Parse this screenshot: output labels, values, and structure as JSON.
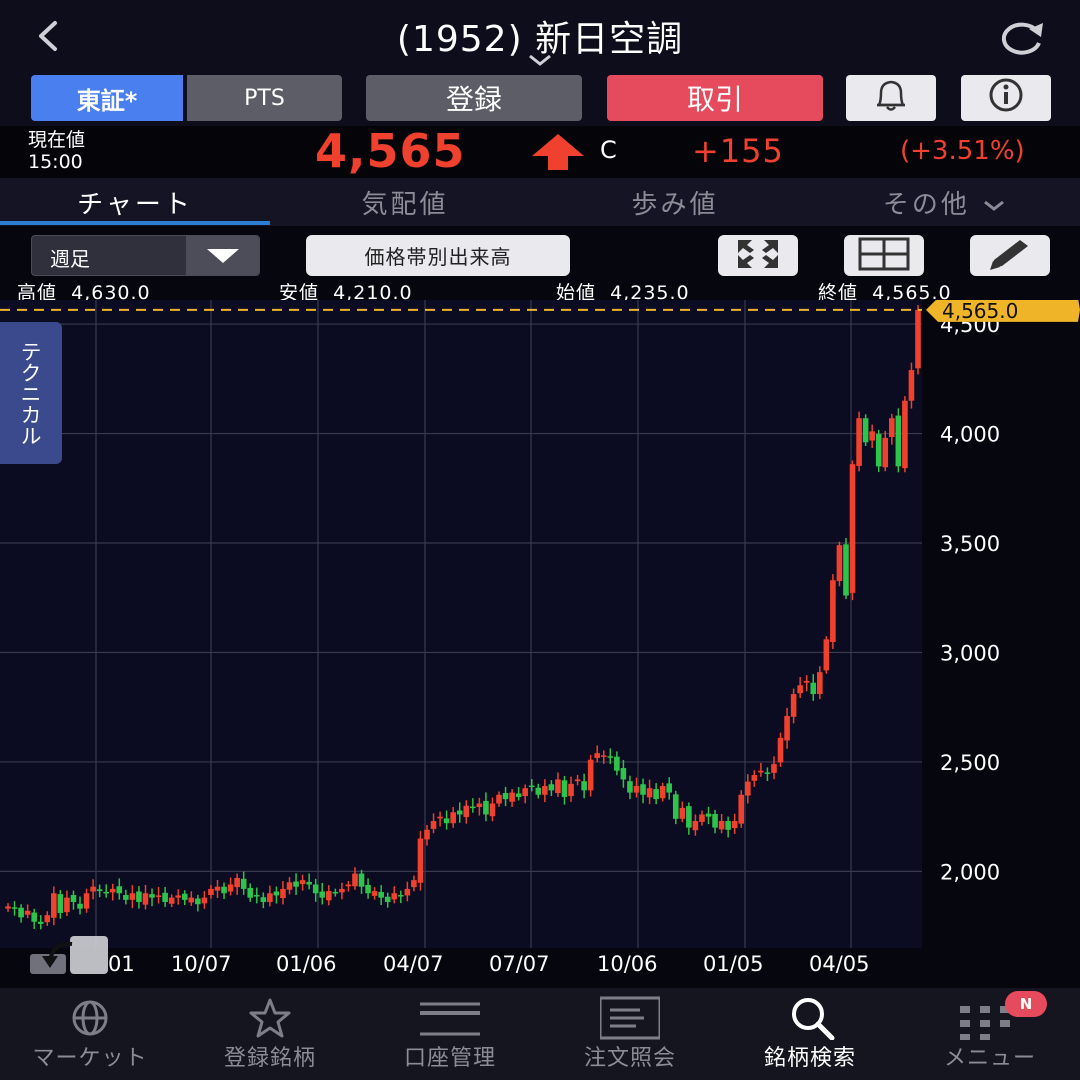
{
  "header": {
    "title": "(1952) 新日空調"
  },
  "toolbar": {
    "exchange_tosho": "東証*",
    "exchange_pts": "PTS",
    "register": "登録",
    "trade": "取引"
  },
  "quote": {
    "label": "現在値",
    "time": "15:00",
    "price": "4,565",
    "c_mark": "C",
    "change": "+155",
    "change_pct": "(+3.51%)",
    "up_color": "#f0412f"
  },
  "tabs": [
    "チャート",
    "気配値",
    "歩み値",
    "その他"
  ],
  "controls": {
    "period": "週足",
    "volume_button": "価格帯別出来高"
  },
  "ohlc": {
    "high_label": "高値",
    "high": "4,630.0",
    "low_label": "安値",
    "low": "4,210.0",
    "open_label": "始値",
    "open": "4,235.0",
    "close_label": "終値",
    "close": "4,565.0"
  },
  "side_tab": "テクニカル",
  "chart_data": {
    "type": "candlestick",
    "y_ticks": [
      4500,
      4000,
      3500,
      3000,
      2500,
      2000
    ],
    "y_tick_labels": [
      "4,500",
      "4,000",
      "3,500",
      "3,000",
      "2,500",
      "2,000"
    ],
    "x_tick_labels": [
      "01",
      "10/07",
      "01/06",
      "04/07",
      "07/07",
      "10/06",
      "01/05",
      "04/05"
    ],
    "last_price_label": "4,565.0",
    "last_price": 4565,
    "ylim": [
      1650,
      4610
    ],
    "up_color": "#f0412f",
    "down_color": "#2ec34a",
    "grid": true,
    "closes": [
      1840,
      1830,
      1790,
      1820,
      1770,
      1760,
      1800,
      1900,
      1810,
      1880,
      1860,
      1830,
      1900,
      1930,
      1910,
      1900,
      1920,
      1900,
      1870,
      1900,
      1860,
      1900,
      1880,
      1890,
      1860,
      1880,
      1890,
      1870,
      1880,
      1850,
      1880,
      1920,
      1930,
      1900,
      1940,
      1970,
      1920,
      1880,
      1890,
      1860,
      1900,
      1890,
      1920,
      1950,
      1930,
      1960,
      1940,
      1900,
      1880,
      1910,
      1900,
      1920,
      1940,
      1990,
      1930,
      1900,
      1910,
      1880,
      1860,
      1900,
      1890,
      1920,
      1960,
      2150,
      2190,
      2230,
      2250,
      2220,
      2270,
      2260,
      2300,
      2290,
      2310,
      2260,
      2310,
      2350,
      2330,
      2360,
      2340,
      2380,
      2390,
      2350,
      2390,
      2370,
      2420,
      2340,
      2400,
      2420,
      2370,
      2510,
      2540,
      2530,
      2520,
      2460,
      2420,
      2360,
      2390,
      2350,
      2380,
      2330,
      2390,
      2360,
      2240,
      2290,
      2200,
      2230,
      2260,
      2250,
      2200,
      2230,
      2190,
      2230,
      2350,
      2410,
      2440,
      2460,
      2450,
      2490,
      2610,
      2710,
      2810,
      2850,
      2870,
      2810,
      2910,
      3060,
      3330,
      3490,
      3260,
      3860,
      4070,
      3960,
      4010,
      3850,
      3980,
      4070,
      3850,
      4150,
      4290,
      4565
    ],
    "highs_note": "wick approx"
  },
  "nav": {
    "items": [
      {
        "label": "マーケット",
        "icon": "globe-icon"
      },
      {
        "label": "登録銘柄",
        "icon": "star-icon"
      },
      {
        "label": "口座管理",
        "icon": "card-icon"
      },
      {
        "label": "注文照会",
        "icon": "document-icon"
      },
      {
        "label": "銘柄検索",
        "icon": "search-icon"
      },
      {
        "label": "メニュー",
        "icon": "grid-menu-icon"
      }
    ],
    "badge": "N"
  }
}
